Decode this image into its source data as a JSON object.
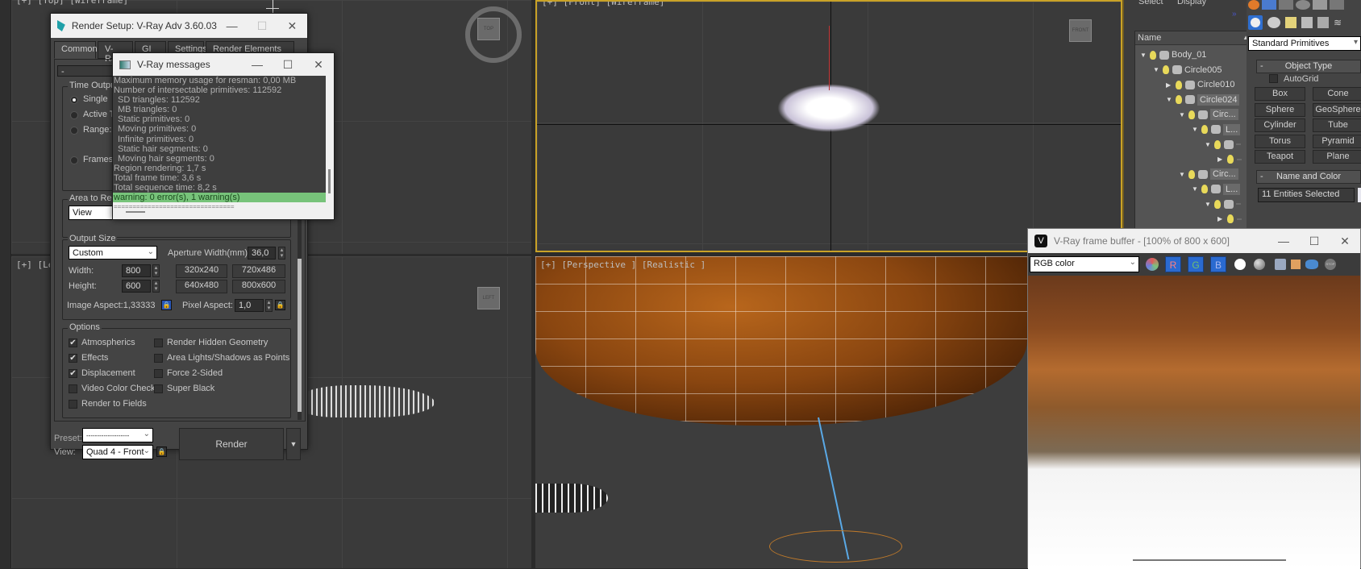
{
  "viewports": {
    "top": {
      "label": "[+] [Top] [Wireframe]"
    },
    "front": {
      "label": "[+] [Front] [Wireframe]",
      "navcube": "FRONT"
    },
    "left": {
      "label": "[+] [Left ]",
      "navcube": "LEFT"
    },
    "perspective": {
      "label": "[+] [Perspective ] [Realistic ]"
    },
    "top_navcube": "TOP"
  },
  "render_setup": {
    "title": "Render Setup: V-Ray Adv 3.60.03",
    "tabs": [
      "Common",
      "V-Ray",
      "GI",
      "Settings",
      "Render Elements"
    ],
    "rollout_toggle": "-",
    "time_output": {
      "title": "Time Output",
      "options": [
        {
          "label": "Single",
          "selected": true
        },
        {
          "label": "Active Ti",
          "selected": false
        },
        {
          "label": "Range:",
          "selected": false
        },
        {
          "label": "Frames",
          "selected": false
        }
      ]
    },
    "area_to_render": {
      "title": "Area to Ren",
      "value": "View"
    },
    "output_size": {
      "title": "Output Size",
      "preset": "Custom",
      "aperture_label": "Aperture Width(mm):",
      "aperture_value": "36,0",
      "width_label": "Width:",
      "width_value": "800",
      "height_label": "Height:",
      "height_value": "600",
      "presets": [
        "320x240",
        "720x486",
        "640x480",
        "800x600"
      ],
      "image_aspect": "Image Aspect:1,33333",
      "pixel_aspect_label": "Pixel Aspect:",
      "pixel_aspect_value": "1,0"
    },
    "options": {
      "title": "Options",
      "left": [
        {
          "label": "Atmospherics",
          "checked": true
        },
        {
          "label": "Effects",
          "checked": true
        },
        {
          "label": "Displacement",
          "checked": true
        },
        {
          "label": "Video Color Check",
          "checked": false
        },
        {
          "label": "Render to Fields",
          "checked": false
        }
      ],
      "right": [
        {
          "label": "Render Hidden Geometry",
          "checked": false
        },
        {
          "label": "Area Lights/Shadows as Points",
          "checked": false
        },
        {
          "label": "Force 2-Sided",
          "checked": false
        },
        {
          "label": "Super Black",
          "checked": false
        }
      ]
    },
    "preset_label": "Preset:",
    "preset_value": "--------------------",
    "view_label": "View:",
    "view_value": "Quad 4 - Front",
    "render_button": "Render"
  },
  "vray_messages": {
    "title": "V-Ray messages",
    "lines": [
      {
        "text": "Maximum memory usage for resman: 0,00 MB",
        "indent": false
      },
      {
        "text": "Number of intersectable primitives: 112592",
        "indent": false
      },
      {
        "text": "SD triangles: 112592",
        "indent": true
      },
      {
        "text": "MB triangles: 0",
        "indent": true
      },
      {
        "text": "Static primitives: 0",
        "indent": true
      },
      {
        "text": "Moving primitives: 0",
        "indent": true
      },
      {
        "text": "Infinite primitives: 0",
        "indent": true
      },
      {
        "text": "Static hair segments: 0",
        "indent": true
      },
      {
        "text": "Moving hair segments: 0",
        "indent": true
      },
      {
        "text": "Region rendering: 1,7 s",
        "indent": false
      },
      {
        "text": "Total frame time: 3,6 s",
        "indent": false
      },
      {
        "text": "Total sequence time: 8,2 s",
        "indent": false
      }
    ],
    "warning_line": "warning: 0 error(s), 1 warning(s)",
    "separator": "================================"
  },
  "scene_explorer": {
    "menu": [
      "Select",
      "Display"
    ],
    "column_header": "Name",
    "items": [
      {
        "label": "Body_01",
        "depth": 0,
        "expanded": true
      },
      {
        "label": "Circle005",
        "depth": 1,
        "expanded": true
      },
      {
        "label": "Circle010",
        "depth": 2,
        "expanded": false
      },
      {
        "label": "Circle024",
        "depth": 2,
        "expanded": true
      },
      {
        "label": "Circ...",
        "depth": 3,
        "expanded": true
      },
      {
        "label": "L...",
        "depth": 4,
        "expanded": true
      },
      {
        "label": "",
        "depth": 5,
        "expanded": true
      },
      {
        "label": "",
        "depth": 6,
        "expanded": false
      },
      {
        "label": "Circ...",
        "depth": 3,
        "expanded": true
      },
      {
        "label": "L...",
        "depth": 4,
        "expanded": true
      },
      {
        "label": "",
        "depth": 5,
        "expanded": true
      },
      {
        "label": "",
        "depth": 6,
        "expanded": false
      }
    ]
  },
  "command_panel": {
    "category": "Standard Primitives",
    "object_type": {
      "title": "Object Type",
      "autogrid": "AutoGrid",
      "buttons": [
        "Box",
        "Cone",
        "Sphere",
        "GeoSphere",
        "Cylinder",
        "Tube",
        "Torus",
        "Pyramid",
        "Teapot",
        "Plane"
      ]
    },
    "name_and_color": {
      "title": "Name and Color",
      "value": "11 Entities Selected"
    }
  },
  "frame_buffer": {
    "title": "V-Ray frame buffer - [100% of 800 x 600]",
    "channel": "RGB color",
    "channels": [
      "R",
      "G",
      "B"
    ],
    "accent": "#2a6ad0"
  }
}
